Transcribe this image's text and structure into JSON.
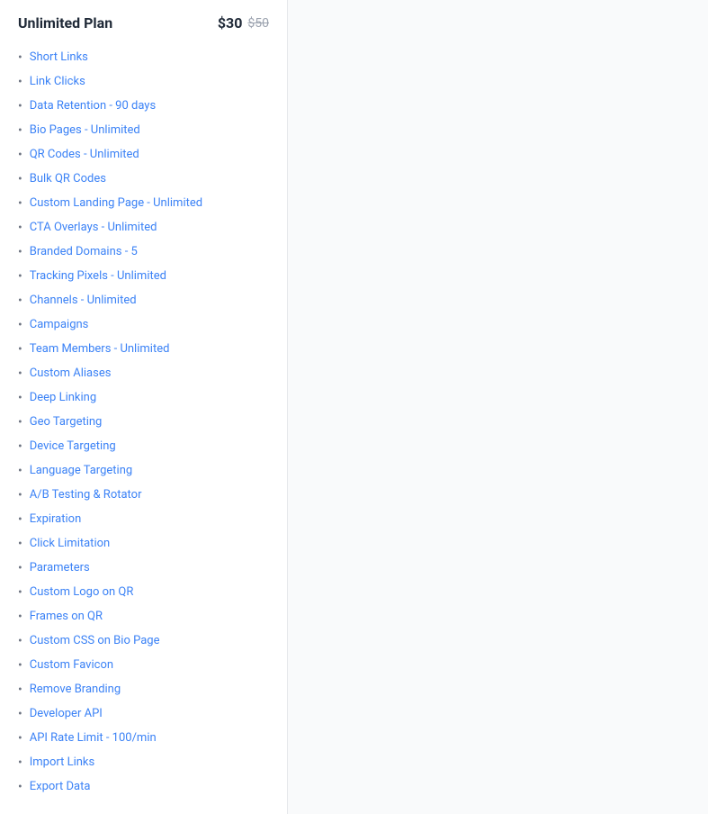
{
  "plan": {
    "name": "Unlimited Plan",
    "price": "$30",
    "original_price": "$50"
  },
  "features": [
    {
      "id": "short-links",
      "label": "Short Links",
      "linked": true
    },
    {
      "id": "link-clicks",
      "label": "Link Clicks",
      "linked": true
    },
    {
      "id": "data-retention",
      "label": "Data Retention - 90 days",
      "linked": true
    },
    {
      "id": "bio-pages",
      "label": "Bio Pages - Unlimited",
      "linked": true
    },
    {
      "id": "qr-codes",
      "label": "QR Codes - Unlimited",
      "linked": true
    },
    {
      "id": "bulk-qr-codes",
      "label": "Bulk QR Codes",
      "linked": true
    },
    {
      "id": "custom-landing-page",
      "label": "Custom Landing Page - Unlimited",
      "linked": true
    },
    {
      "id": "cta-overlays",
      "label": "CTA Overlays - Unlimited",
      "linked": true
    },
    {
      "id": "branded-domains",
      "label": "Branded Domains - 5",
      "linked": true
    },
    {
      "id": "tracking-pixels",
      "label": "Tracking Pixels - Unlimited",
      "linked": true
    },
    {
      "id": "channels",
      "label": "Channels - Unlimited",
      "linked": true
    },
    {
      "id": "campaigns",
      "label": "Campaigns",
      "linked": true
    },
    {
      "id": "team-members",
      "label": "Team Members - Unlimited",
      "linked": true
    },
    {
      "id": "custom-aliases",
      "label": "Custom Aliases",
      "linked": true
    },
    {
      "id": "deep-linking",
      "label": "Deep Linking",
      "linked": true
    },
    {
      "id": "geo-targeting",
      "label": "Geo Targeting",
      "linked": true
    },
    {
      "id": "device-targeting",
      "label": "Device Targeting",
      "linked": true
    },
    {
      "id": "language-targeting",
      "label": "Language Targeting",
      "linked": true
    },
    {
      "id": "ab-testing",
      "label": "A/B Testing & Rotator",
      "linked": true
    },
    {
      "id": "expiration",
      "label": "Expiration",
      "linked": true
    },
    {
      "id": "click-limitation",
      "label": "Click Limitation",
      "linked": true
    },
    {
      "id": "parameters",
      "label": "Parameters",
      "linked": true
    },
    {
      "id": "custom-logo-qr",
      "label": "Custom Logo on QR",
      "linked": true
    },
    {
      "id": "frames-on-qr",
      "label": "Frames on QR",
      "linked": true
    },
    {
      "id": "custom-css-bio",
      "label": "Custom CSS on Bio Page",
      "linked": true
    },
    {
      "id": "custom-favicon",
      "label": "Custom Favicon",
      "linked": true
    },
    {
      "id": "remove-branding",
      "label": "Remove Branding",
      "linked": true
    },
    {
      "id": "developer-api",
      "label": "Developer API",
      "linked": true
    },
    {
      "id": "api-rate-limit",
      "label": "API Rate Limit - 100/min",
      "linked": true
    },
    {
      "id": "import-links",
      "label": "Import Links",
      "linked": true
    },
    {
      "id": "export-data",
      "label": "Export Data",
      "linked": true
    }
  ]
}
